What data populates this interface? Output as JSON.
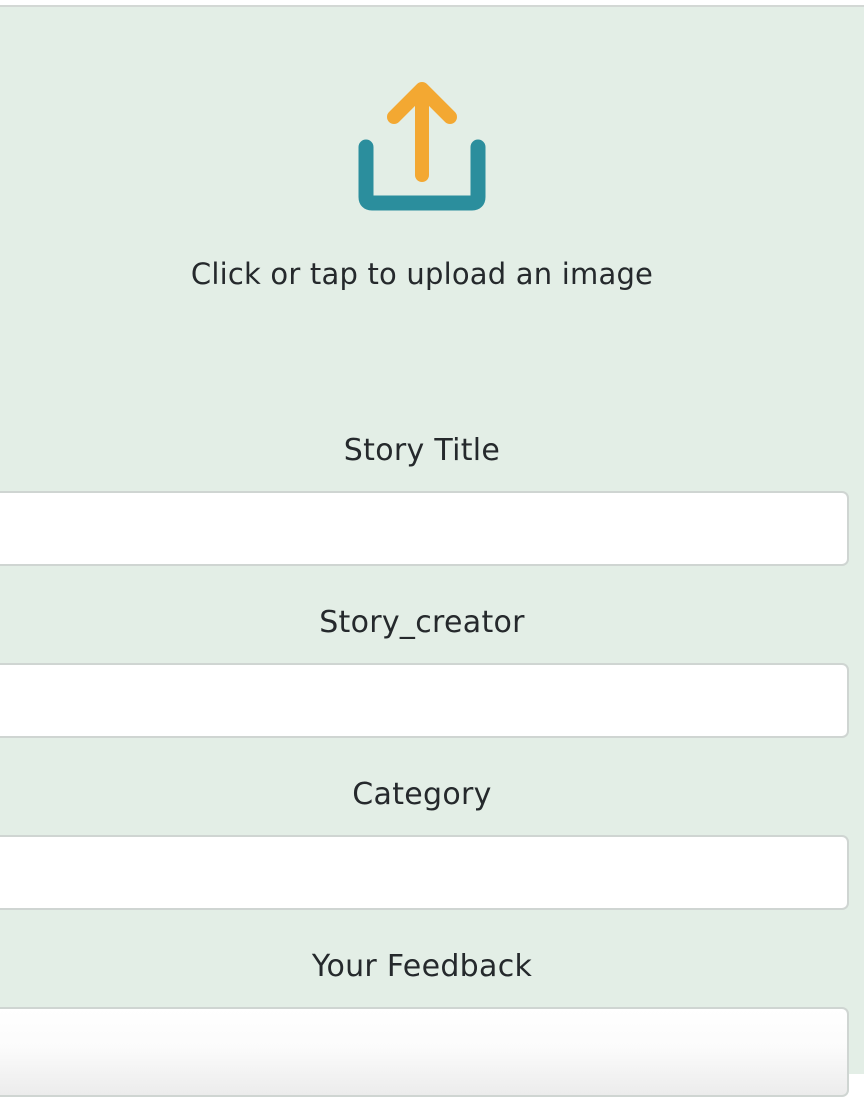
{
  "upload": {
    "text": "Click or tap to upload an image",
    "icon": "upload-icon",
    "colors": {
      "arrow": "#f3a832",
      "tray": "#2b8e9d"
    }
  },
  "fields": {
    "story_title": {
      "label": "Story Title",
      "value": ""
    },
    "story_creator": {
      "label": "Story_creator",
      "value": ""
    },
    "category": {
      "label": "Category",
      "value": ""
    },
    "feedback": {
      "label": "Your Feedback",
      "value": ""
    }
  },
  "colors": {
    "panel_background": "#e3eee6",
    "input_border": "#cfd5d2",
    "text": "#25292c"
  }
}
